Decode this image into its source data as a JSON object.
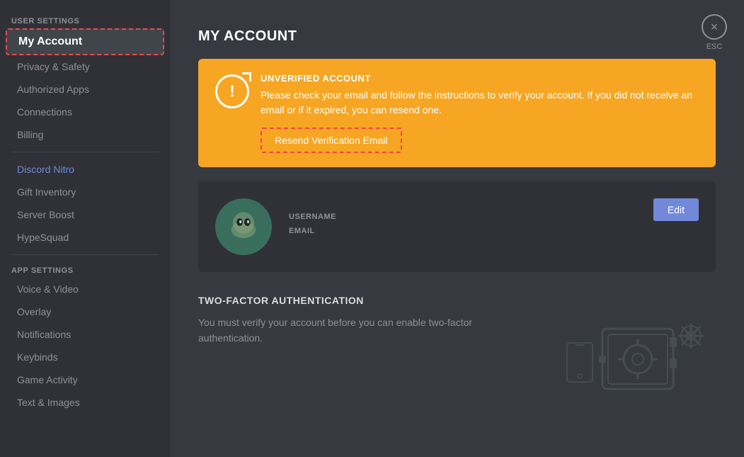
{
  "sidebar": {
    "user_settings_label": "USER SETTINGS",
    "app_settings_label": "APP SETTINGS",
    "items": {
      "my_account": "My Account",
      "privacy_safety": "Privacy & Safety",
      "authorized_apps": "Authorized Apps",
      "connections": "Connections",
      "billing": "Billing",
      "discord_nitro": "Discord Nitro",
      "gift_inventory": "Gift Inventory",
      "server_boost": "Server Boost",
      "hypesquad": "HypeSquad",
      "voice_video": "Voice & Video",
      "overlay": "Overlay",
      "notifications": "Notifications",
      "keybinds": "Keybinds",
      "game_activity": "Game Activity",
      "text_images": "Text & Images"
    }
  },
  "main": {
    "page_title": "MY ACCOUNT",
    "banner": {
      "title": "UNVERIFIED ACCOUNT",
      "description": "Please check your email and follow the instructions to verify your account. If you did not receive an email or if it expired, you can resend one.",
      "resend_button": "Resend Verification Email"
    },
    "account": {
      "username_label": "USERNAME",
      "email_label": "EMAIL",
      "edit_button": "Edit"
    },
    "tfa": {
      "section_title": "TWO-FACTOR AUTHENTICATION",
      "description": "You must verify your account before you can enable two-factor authentication."
    },
    "close": {
      "button_label": "×",
      "esc_label": "ESC"
    }
  }
}
